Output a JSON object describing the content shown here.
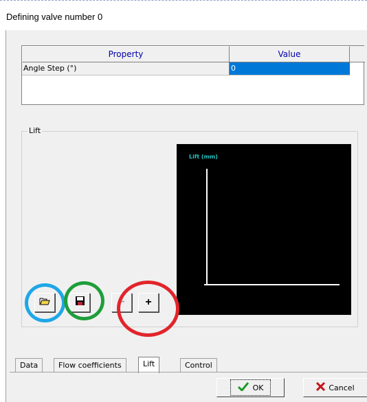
{
  "window": {
    "title": "Defining valve number 0"
  },
  "property_grid": {
    "headers": {
      "property": "Property",
      "value": "Value"
    },
    "rows": [
      {
        "property": "Angle Step (°)",
        "value": "0"
      }
    ]
  },
  "lift_group": {
    "label": "Lift",
    "chart": {
      "axis_label": "Lift (mm)"
    }
  },
  "toolbar": {
    "open_icon": "folder-open-icon",
    "save_icon": "floppy-disk-icon",
    "remove_label": "−",
    "add_label": "+"
  },
  "annotations": {
    "blue": "#1ea7e6",
    "green": "#1e9e3a",
    "red": "#e1252b"
  },
  "tabs": [
    {
      "label": "Data"
    },
    {
      "label": "Flow coefficients"
    },
    {
      "label": "Lift",
      "active": true
    },
    {
      "label": "Control"
    }
  ],
  "buttons": {
    "ok": "OK",
    "cancel": "Cancel"
  }
}
